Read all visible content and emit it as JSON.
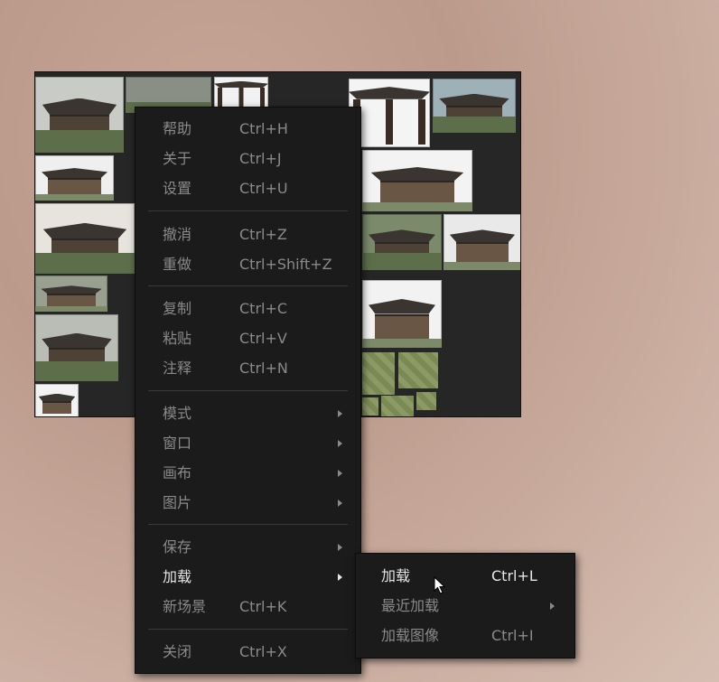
{
  "main_menu": {
    "items": [
      {
        "label": "帮助",
        "shortcut": "Ctrl+H"
      },
      {
        "label": "关于",
        "shortcut": "Ctrl+J"
      },
      {
        "label": "设置",
        "shortcut": "Ctrl+U"
      },
      {
        "label": "撤消",
        "shortcut": "Ctrl+Z"
      },
      {
        "label": "重做",
        "shortcut": "Ctrl+Shift+Z"
      },
      {
        "label": "复制",
        "shortcut": "Ctrl+C"
      },
      {
        "label": "粘贴",
        "shortcut": "Ctrl+V"
      },
      {
        "label": "注释",
        "shortcut": "Ctrl+N"
      },
      {
        "label": "模式",
        "submenu": true
      },
      {
        "label": "窗口",
        "submenu": true
      },
      {
        "label": "画布",
        "submenu": true
      },
      {
        "label": "图片",
        "submenu": true
      },
      {
        "label": "保存",
        "submenu": true
      },
      {
        "label": "加载",
        "submenu": true,
        "active": true
      },
      {
        "label": "新场景",
        "shortcut": "Ctrl+K"
      },
      {
        "label": "关闭",
        "shortcut": "Ctrl+X"
      }
    ]
  },
  "load_submenu": {
    "items": [
      {
        "label": "加载",
        "shortcut": "Ctrl+L",
        "active": true
      },
      {
        "label": "最近加载",
        "submenu": true
      },
      {
        "label": "加载图像",
        "shortcut": "Ctrl+I"
      }
    ]
  },
  "colors": {
    "menu_bg": "#1b1b1b",
    "menu_text": "#8a8a8a",
    "menu_text_active": "#e6e6e6",
    "canvas_bg": "#262626"
  },
  "icons": {
    "submenu_arrow": "chevron-right-icon",
    "cursor": "mouse-pointer-icon"
  }
}
